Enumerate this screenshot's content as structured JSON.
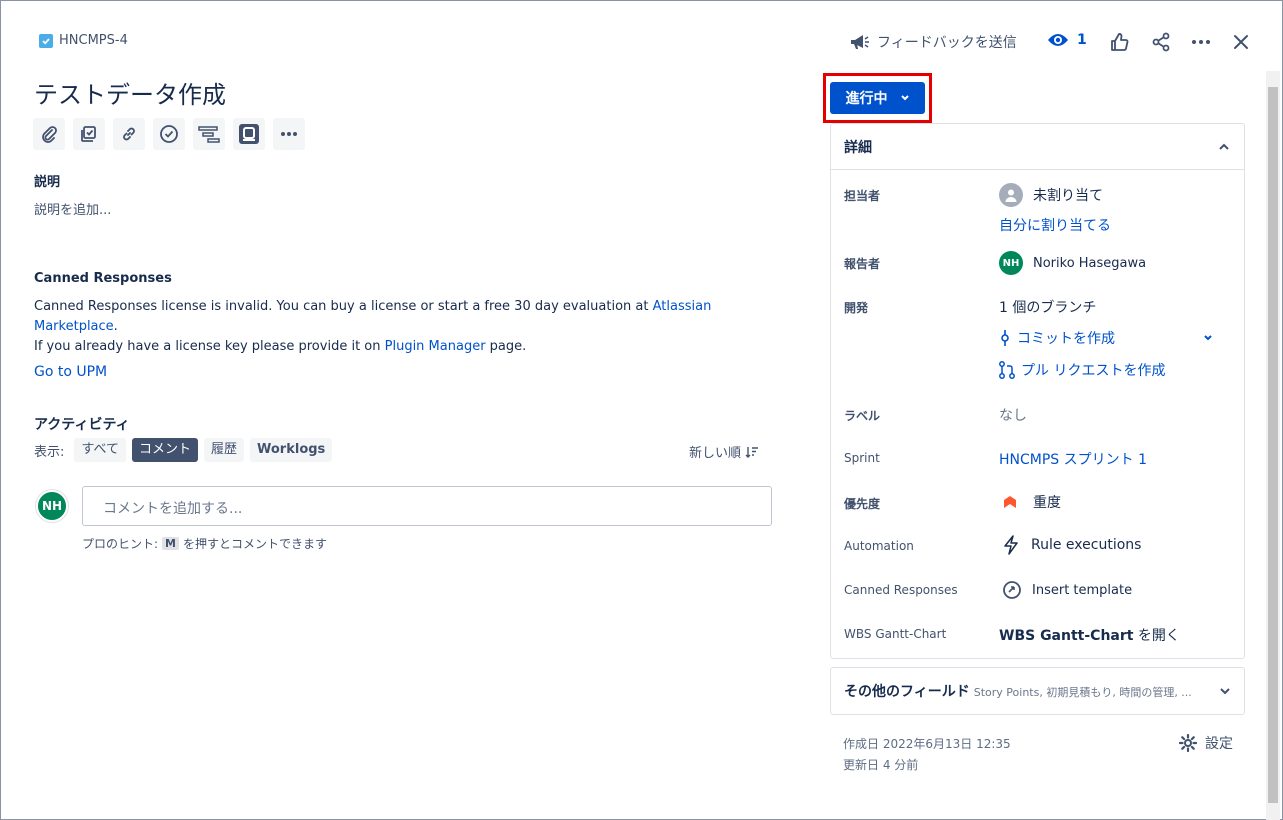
{
  "header": {
    "issue_key": "HNCMPS-4",
    "feedback_label": "フィードバックを送信",
    "watch_count": "1"
  },
  "issue": {
    "title": "テストデータ作成"
  },
  "description": {
    "label": "説明",
    "placeholder": "説明を追加..."
  },
  "canned": {
    "heading": "Canned Responses",
    "line1_text": "Canned Responses license is invalid. You can buy a license or start a free 30 day evaluation at ",
    "line1_link": "Atlassian Marketplace",
    "line1_end": ".",
    "line2_text": "If you already have a license key please provide it on ",
    "line2_link": "Plugin Manager",
    "line2_end": " page.",
    "upm_link": "Go to UPM"
  },
  "activity": {
    "heading": "アクティビティ",
    "show_label": "表示:",
    "filters": [
      "すべて",
      "コメント",
      "履歴",
      "Worklogs"
    ],
    "active_filter": "コメント",
    "sort_label": "新しい順",
    "avatar_initials": "NH",
    "comment_placeholder": "コメントを追加する...",
    "hint_prefix": "プロのヒント:",
    "hint_key": "M",
    "hint_suffix": "を押すとコメントできます"
  },
  "status": {
    "label": "進行中"
  },
  "details": {
    "heading": "詳細",
    "assignee_label": "担当者",
    "assignee_value": "未割り当て",
    "assign_self": "自分に割り当てる",
    "reporter_label": "報告者",
    "reporter_initials": "NH",
    "reporter_value": "Noriko Hasegawa",
    "dev_label": "開発",
    "dev_branch": "1 個のブランチ",
    "dev_commit": "コミットを作成",
    "dev_pr": "プル リクエストを作成",
    "label_label": "ラベル",
    "label_value": "なし",
    "sprint_label": "Sprint",
    "sprint_value": "HNCMPS スプリント 1",
    "priority_label": "優先度",
    "priority_value": "重度",
    "automation_label": "Automation",
    "automation_value": "Rule executions",
    "canned_label": "Canned Responses",
    "canned_value": "Insert template",
    "wbs_label": "WBS Gantt-Chart",
    "wbs_value_bold": "WBS Gantt-Chart",
    "wbs_value_rest": " を開く"
  },
  "other_fields": {
    "heading": "その他のフィールド",
    "summary": "Story Points, 初期見積もり, 時間の管理, ..."
  },
  "meta": {
    "created": "作成日 2022年6月13日 12:35",
    "updated": "更新日 4 分前",
    "settings_label": "設定"
  },
  "colors": {
    "brand": "#0052cc",
    "status_highlight": "#e50000",
    "avatar": "#00875a",
    "priority": "#ff5630"
  }
}
